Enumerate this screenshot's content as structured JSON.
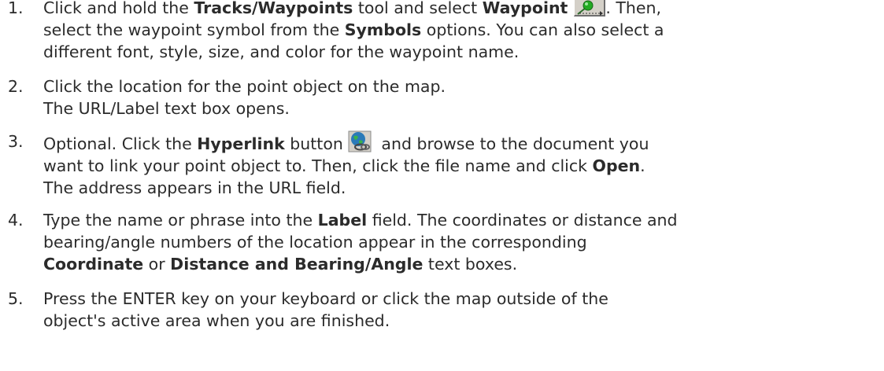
{
  "steps": [
    {
      "number": "1.",
      "line1_pre": "Click and hold the ",
      "line1_b1": "Tracks/Waypoints",
      "line1_mid": " tool and select ",
      "line1_b2": "Waypoint",
      "line1_post": ". Then,",
      "line2_pre": "select the waypoint symbol from the ",
      "line2_b1": "Symbols",
      "line2_post": " options. You can also select a",
      "line3": "different font, style, size, and color for the waypoint name.",
      "icon": "waypoint-tool-icon"
    },
    {
      "number": "2.",
      "line1": "Click the location for the point object on the map.",
      "line2": "The URL/Label text box opens."
    },
    {
      "number": "3.",
      "line1_pre": "Optional. Click the ",
      "line1_b1": "Hyperlink",
      "line1_mid": " button",
      "line1_post": " and browse to the document you",
      "line2_pre": "want to link your point object to. Then, click the file name and click ",
      "line2_b1": "Open",
      "line2_post": ".",
      "line3": "The address appears in the URL field.",
      "icon": "hyperlink-globe-icon"
    },
    {
      "number": "4.",
      "line1_pre": "Type the name or phrase into the ",
      "line1_b1": "Label",
      "line1_post": " field. The coordinates or distance and",
      "line2": "bearing/angle numbers of the location appear in the corresponding",
      "line3_b1": "Coordinate",
      "line3_mid": " or ",
      "line3_b2": "Distance and Bearing/Angle",
      "line3_post": " text boxes."
    },
    {
      "number": "5.",
      "line1": "Press the ENTER key on your keyboard or click the map outside of the",
      "line2": "object's active area when you are finished."
    }
  ],
  "colors": {
    "text": "#2b2b2b",
    "globe": "#2a7ab8",
    "pin": "#22aa22"
  }
}
